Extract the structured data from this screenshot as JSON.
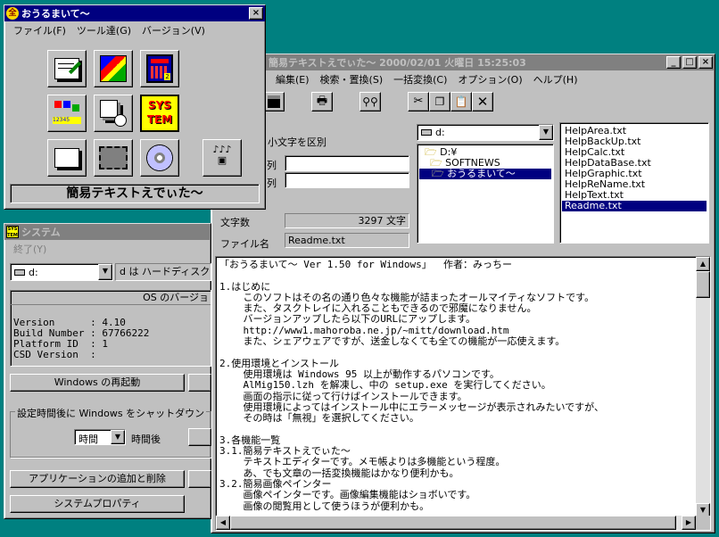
{
  "main_window": {
    "title": "簡易テキストえでぃた～  2000/02/01  火曜日  15:25:03",
    "menu": [
      "編集(E)",
      "検索・置換(S)",
      "一括変換(C)",
      "オプション(O)",
      "ヘルプ(H)"
    ],
    "case_label": "・小文字を区別",
    "row1_label": "列",
    "row2_label": "列",
    "drive": "d:",
    "folders": [
      "D:¥",
      "SOFTNEWS",
      "おうるまいて～"
    ],
    "files": [
      "HelpArea.txt",
      "HelpBackUp.txt",
      "HelpCalc.txt",
      "HelpDataBase.txt",
      "HelpGraphic.txt",
      "HelpReName.txt",
      "HelpText.txt",
      "Readme.txt"
    ],
    "selected_file": "Readme.txt",
    "char_count_label": "文字数",
    "char_count_value": "3297 文字",
    "filename_label": "ファイル名",
    "filename_value": "Readme.txt",
    "text_lines": [
      "「おうるまいて～ Ver 1.50 for Windows」  作者：みっちー",
      "",
      "1.はじめに",
      "    このソフトはその名の通り色々な機能が詰まったオールマイティなソフトです。",
      "    また、タスクトレイに入れることもできるので邪魔になりません。",
      "    バージョンアップしたら以下のURLにアップします。",
      "    http://www1.mahoroba.ne.jp/~mitt/download.htm",
      "    また、シェアウェアですが、送金しなくても全ての機能が一応使えます。",
      "",
      "2.使用環境とインストール",
      "    使用環境は Windows 95 以上が動作するパソコンです。",
      "    AlMig150.lzh を解凍し、中の setup.exe を実行してください。",
      "    画面の指示に従って行けばインストールできます。",
      "    使用環境によってはインストール中にエラーメッセージが表示されみたいですが、",
      "    その時は「無視」を選択してください。",
      "",
      "3.各機能一覧",
      "3.1.簡易テキストえでぃた～",
      "    テキストエディターです。メモ帳よりは多機能という程度。",
      "    あ、でも文章の一括変換機能はかなり便利かも。",
      "3.2.簡易画像ペインター",
      "    画像ペインターです。画像編集機能はショボいです。",
      "    画像の閲覧用として使うほうが便利かも。"
    ]
  },
  "launcher_window": {
    "title": "おうるまいて～",
    "menu": [
      "ファイル(F)",
      "ツール達(G)",
      "バージョン(V)"
    ],
    "icons": [
      "text-editor",
      "paint",
      "calculator",
      "database",
      "backup",
      "system",
      "terminal",
      "film",
      "cd",
      "audio"
    ],
    "status": "簡易テキストえでぃた～"
  },
  "system_window": {
    "title": "システム",
    "menu": [
      "終了(Y)"
    ],
    "drive": "d:",
    "drive_type": "d は ハードディスク",
    "os_version_header": "OS のバージョ",
    "os_info": [
      "Version      : 4.10",
      "Build Number : 67766222",
      "Platform ID  : 1",
      "CSD Version  :"
    ],
    "restart_button": "Windows の再起動",
    "shutdown_group": "設定時間後に Windows をシャットダウン",
    "time_unit": "時間",
    "after_label": "時間後",
    "add_remove_button": "アプリケーションの追加と削除",
    "properties_button": "システムプロパティ"
  },
  "colors": {
    "desktop": "#008080",
    "title_active": "#000080",
    "title_inactive": "#808080",
    "face": "#c0c0c0"
  }
}
